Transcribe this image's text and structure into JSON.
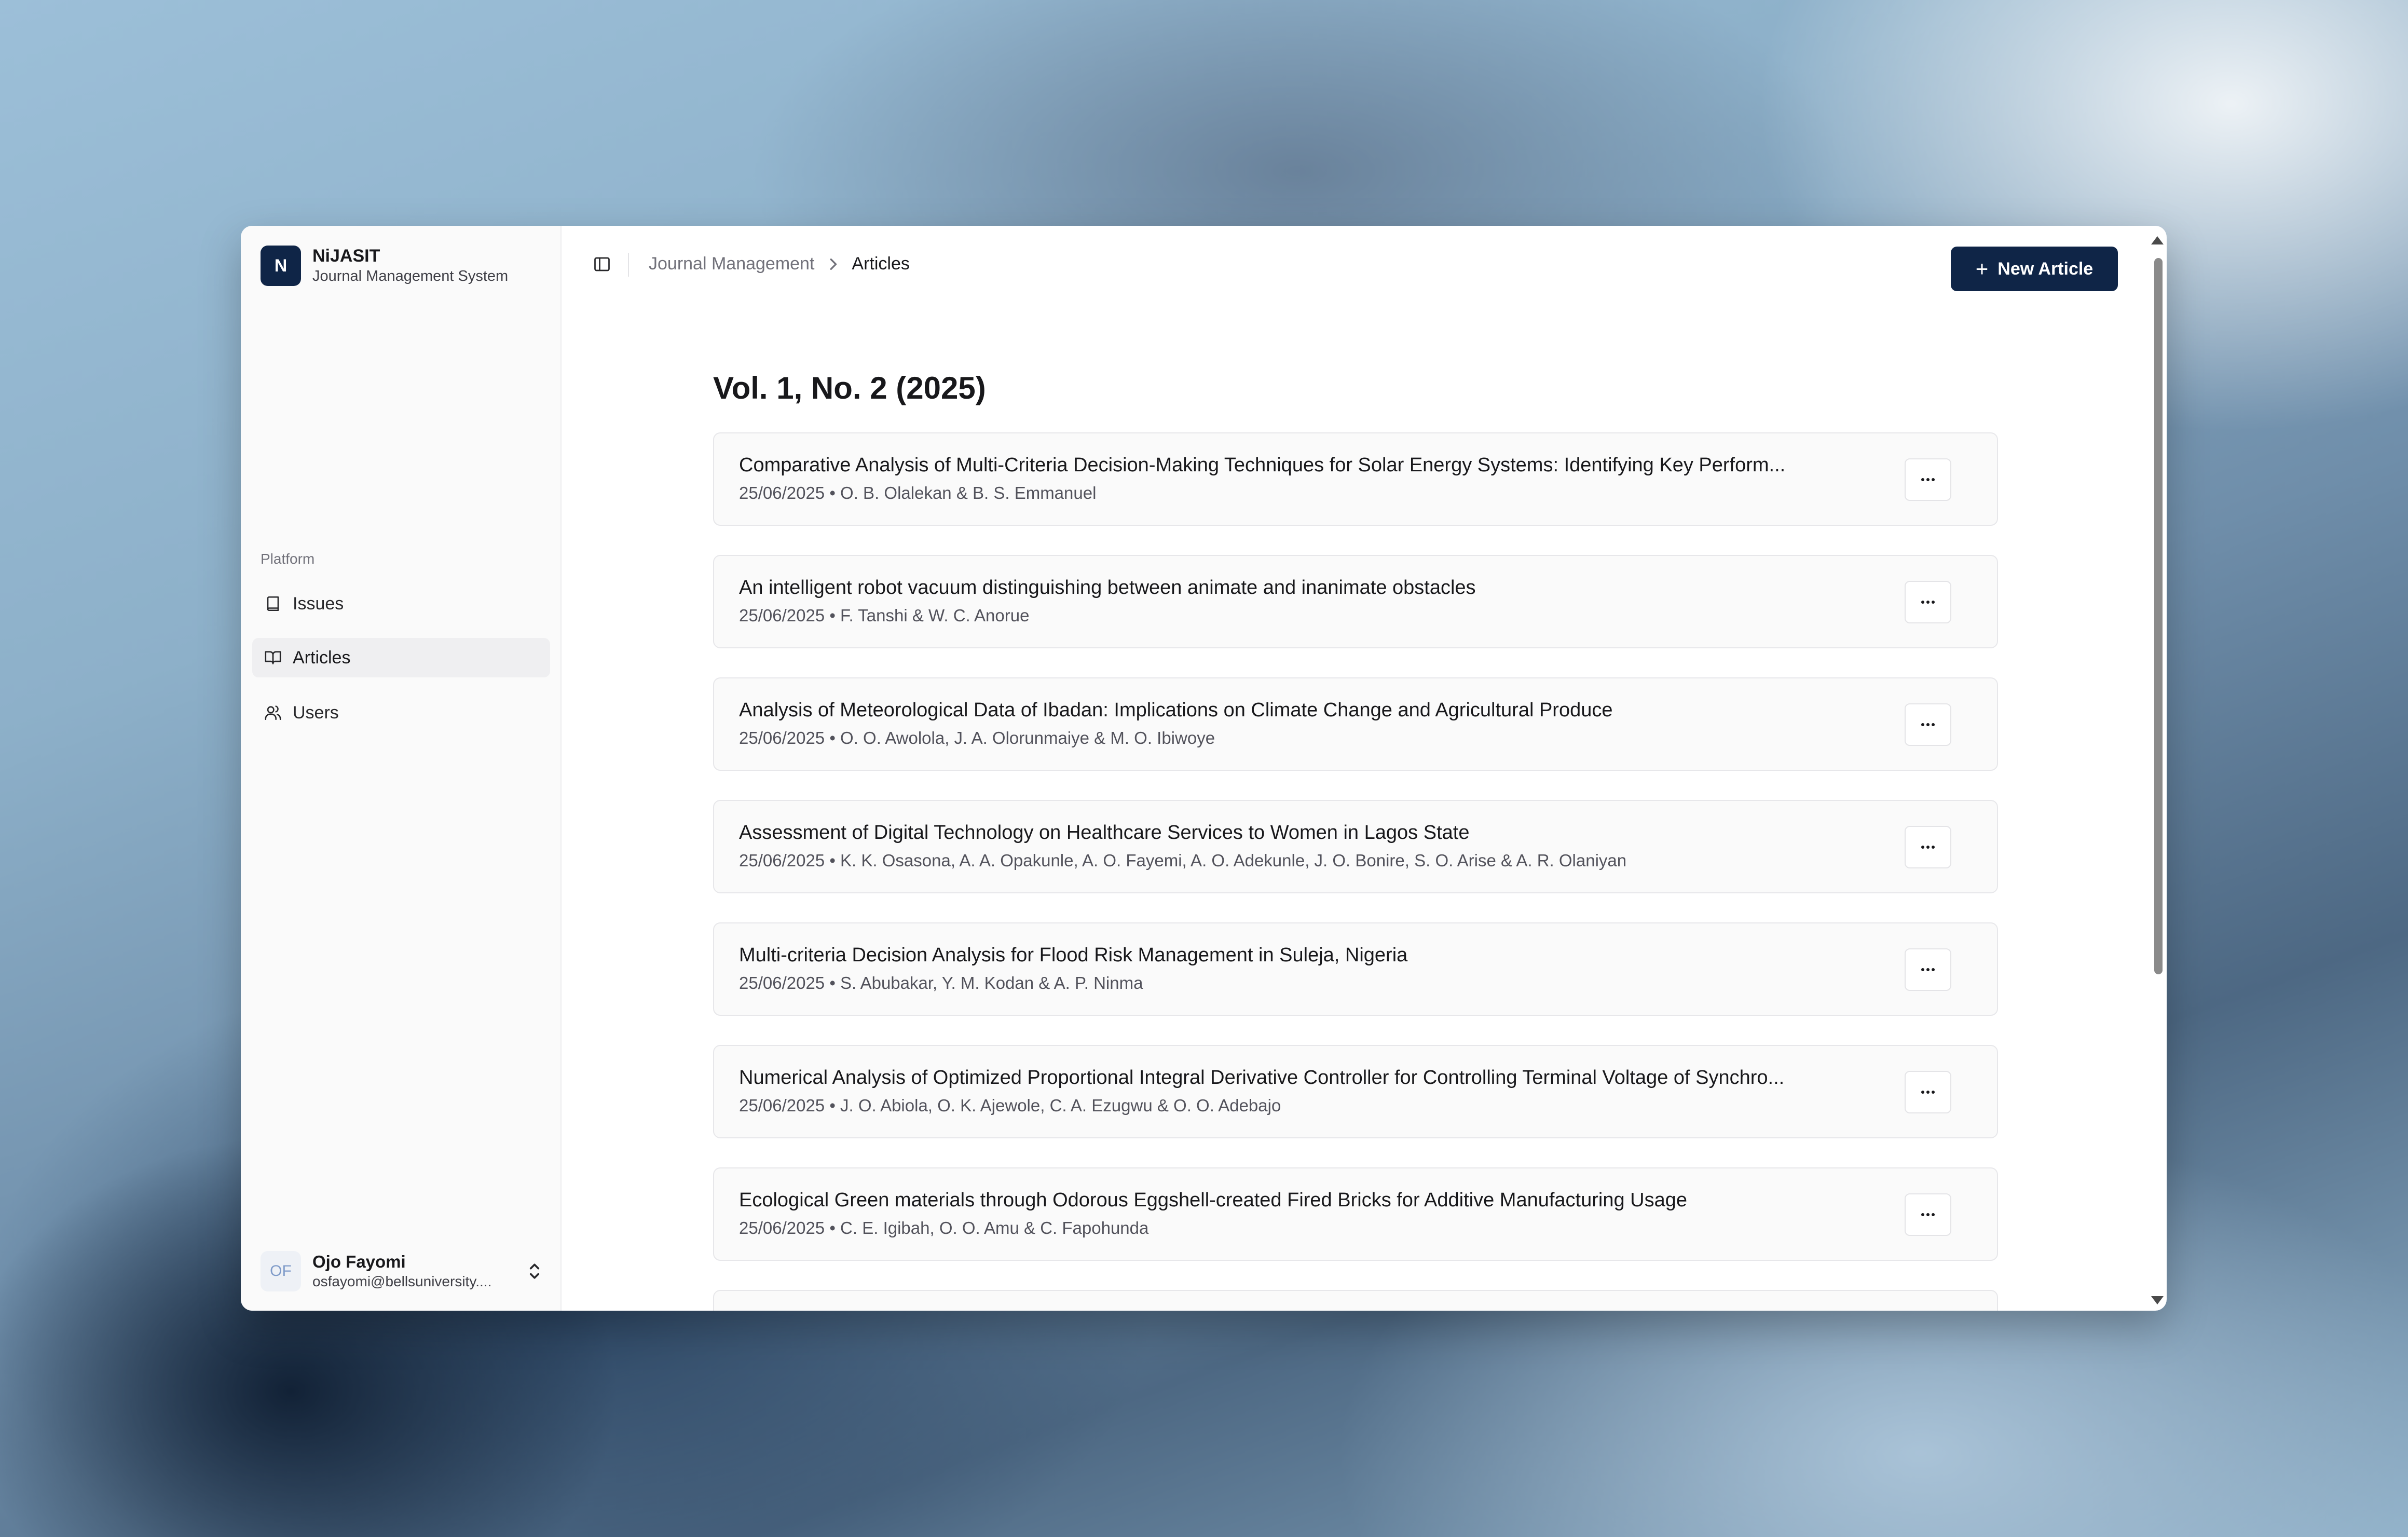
{
  "brand": {
    "logo_letter": "N",
    "name": "NiJASIT",
    "subtitle": "Journal Management System"
  },
  "sidebar": {
    "section_label": "Platform",
    "items": [
      {
        "label": "Issues",
        "icon": "book-icon"
      },
      {
        "label": "Articles",
        "icon": "open-book-icon",
        "active": true
      },
      {
        "label": "Users",
        "icon": "users-icon"
      }
    ]
  },
  "user": {
    "initials": "OF",
    "name": "Ojo Fayomi",
    "email": "osfayomi@bellsuniversity...."
  },
  "breadcrumb": {
    "parent": "Journal Management",
    "current": "Articles"
  },
  "toolbar": {
    "new_article_label": "New Article"
  },
  "issue": {
    "title": "Vol. 1, No. 2 (2025)"
  },
  "articles": [
    {
      "title": "Comparative Analysis of Multi-Criteria Decision-Making Techniques for Solar Energy Systems: Identifying Key Perform...",
      "meta": "25/06/2025 • O. B. Olalekan & B. S. Emmanuel"
    },
    {
      "title": "An intelligent robot vacuum distinguishing between animate and inanimate obstacles",
      "meta": "25/06/2025 • F. Tanshi & W. C. Anorue"
    },
    {
      "title": "Analysis of Meteorological Data of Ibadan: Implications on Climate Change and Agricultural Produce",
      "meta": "25/06/2025 • O. O. Awolola, J. A. Olorunmaiye & M. O. Ibiwoye"
    },
    {
      "title": "Assessment of Digital Technology on Healthcare Services to Women in Lagos State",
      "meta": "25/06/2025 • K. K. Osasona, A. A. Opakunle, A. O. Fayemi, A. O. Adekunle, J. O. Bonire, S. O. Arise & A. R. Olaniyan"
    },
    {
      "title": "Multi-criteria Decision Analysis for Flood Risk Management in Suleja, Nigeria",
      "meta": "25/06/2025 • S. Abubakar, Y. M. Kodan & A. P. Ninma"
    },
    {
      "title": "Numerical Analysis of Optimized Proportional Integral Derivative Controller for Controlling Terminal Voltage of Synchro...",
      "meta": "25/06/2025 • J. O. Abiola, O. K. Ajewole, C. A. Ezugwu & O. O. Adebajo"
    },
    {
      "title": "Ecological Green materials through Odorous Eggshell-created Fired Bricks for Additive Manufacturing Usage",
      "meta": "25/06/2025 • C. E. Igibah, O. O. Amu & C. Fapohunda"
    }
  ]
}
